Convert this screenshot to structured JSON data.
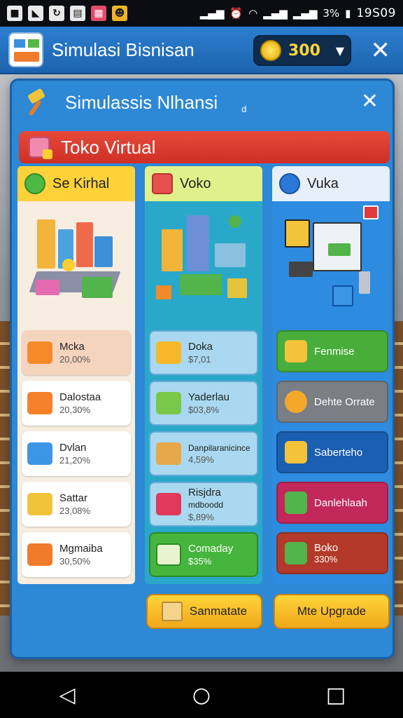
{
  "status_bar": {
    "left_icons": [
      "notification-icon",
      "photos-icon",
      "app-icon",
      "message-icon",
      "game-icon-1",
      "game-icon-2"
    ],
    "battery": "3%",
    "time": "19S09"
  },
  "app_bar": {
    "title": "Simulasi Bisnisan",
    "coins": "300"
  },
  "modal": {
    "title": "Simulassis Nlhansi",
    "subtitle_mark": "d",
    "banner_title": "Toko Virtual"
  },
  "columns": [
    {
      "title": "Se Kirhal",
      "tiles": [
        {
          "name": "Mcka",
          "value": "20,00%"
        },
        {
          "name": "Dalostaa",
          "value": "20,30%"
        },
        {
          "name": "Dvlan",
          "value": "21,20%"
        },
        {
          "name": "Sattar",
          "value": "23,08%"
        },
        {
          "name": "Mgmaiba",
          "value": "30,50%"
        }
      ]
    },
    {
      "title": "Voko",
      "tiles": [
        {
          "name": "Doka",
          "value": "$7,01"
        },
        {
          "name": "Yaderlau",
          "value": "$03,8%"
        },
        {
          "name": "Danpilaranicince",
          "value": "4,59%"
        },
        {
          "name": "Risjdra",
          "name2": "mdboodd",
          "value": "$,89%"
        },
        {
          "name": "Comaday",
          "value": "$35%"
        }
      ]
    },
    {
      "title": "Vuka",
      "options": [
        {
          "name": "Fenmise",
          "value": ""
        },
        {
          "name": "Dehte Orrate",
          "value": ""
        },
        {
          "name": "Saberteho",
          "value": ""
        },
        {
          "name": "Danlehlaah",
          "value": ""
        },
        {
          "name": "Boko",
          "value": "330%"
        }
      ]
    }
  ],
  "buttons": {
    "left": "Sanmatate",
    "right": "Mte Upgrade"
  },
  "colors": {
    "modal_bg": "#2d88d6",
    "banner": "#e64a3a",
    "accent_yellow": "#ffd43a"
  }
}
